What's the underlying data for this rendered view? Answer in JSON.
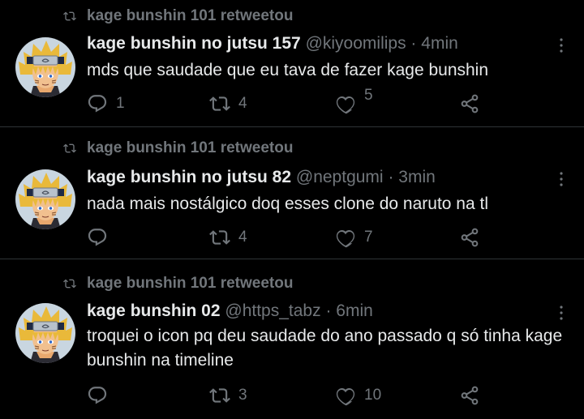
{
  "tweets": [
    {
      "retweeted_by": "kage bunshin 101 retweetou",
      "name": "kage bunshin no jutsu 157",
      "handle": "@kiyoomilips",
      "separator": "·",
      "time": "4min",
      "text": "mds que saudade que eu tava de fazer kage bunshin",
      "reply_count": "1",
      "retweet_count": "4",
      "like_count": "5"
    },
    {
      "retweeted_by": "kage bunshin 101 retweetou",
      "name": "kage bunshin no jutsu 82",
      "handle": "@neptgumi",
      "separator": "·",
      "time": "3min",
      "text": "nada mais nostálgico doq esses clone do naruto na tl",
      "reply_count": "",
      "retweet_count": "4",
      "like_count": "7"
    },
    {
      "retweeted_by": "kage bunshin 101 retweetou",
      "name": "kage bunshin 02",
      "handle": "@https_tabz",
      "separator": "·",
      "time": "6min",
      "text": "troquei o icon pq deu saudade do ano passado q só tinha kage bunshin na timeline",
      "reply_count": "",
      "retweet_count": "3",
      "like_count": "10"
    }
  ],
  "icons": {
    "retweet": "retweet-icon",
    "reply": "reply-icon",
    "like": "heart-icon",
    "share": "share-icon",
    "more": "more-icon"
  },
  "colors": {
    "background": "#000000",
    "text": "#e7e9ea",
    "muted": "#71767b",
    "divider": "#2f3336"
  }
}
